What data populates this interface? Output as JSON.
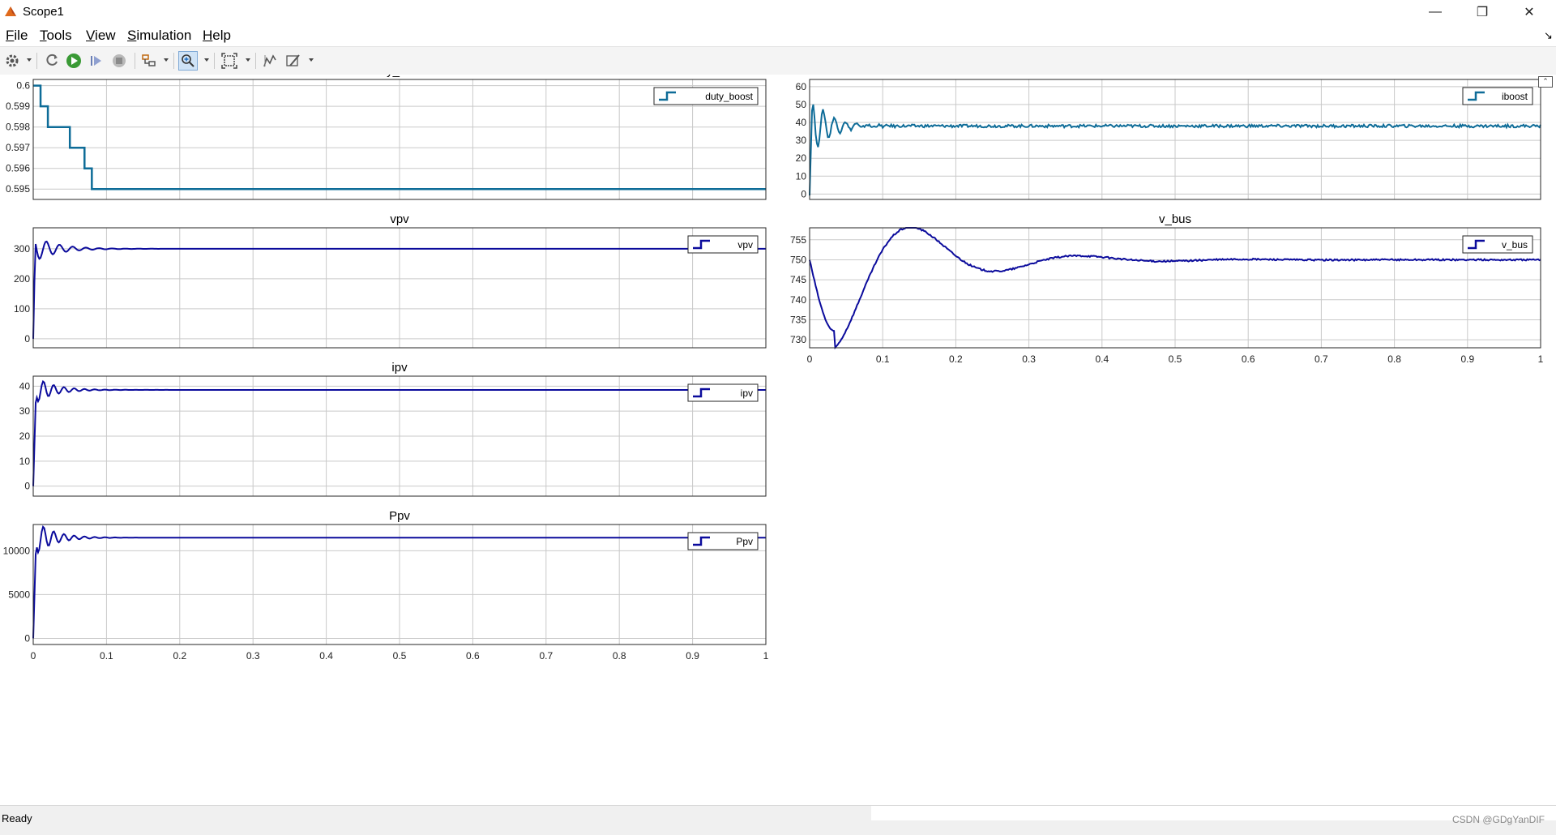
{
  "window": {
    "title": "Scope1",
    "minimize_glyph": "—",
    "maximize_glyph": "❐",
    "close_glyph": "✕"
  },
  "menu": {
    "items": [
      {
        "label": "File",
        "underline": "F",
        "rest": "ile"
      },
      {
        "label": "Tools",
        "underline": "T",
        "rest": "ools"
      },
      {
        "label": "View",
        "underline": "V",
        "rest": "iew"
      },
      {
        "label": "Simulation",
        "underline": "S",
        "rest": "imulation"
      },
      {
        "label": "Help",
        "underline": "H",
        "rest": "elp"
      }
    ],
    "undock_glyph": "↘"
  },
  "toolbar": {
    "icons": [
      "gear-icon",
      "step-back-icon",
      "run-icon",
      "step-forward-icon",
      "stop-icon",
      "highlight-icon",
      "zoom-icon",
      "fit-view-icon",
      "cursor-measure-icon",
      "style-icon"
    ]
  },
  "status": {
    "text": "Ready",
    "watermark": "CSDN @GDgYanDIF"
  },
  "chart_data": [
    {
      "type": "line",
      "title": "duty_boost",
      "legend": "duty_boost",
      "color": "#0e6c98",
      "xlim": [
        0,
        1
      ],
      "ylim": [
        0.5945,
        0.6003
      ],
      "yticks": [
        "0.6",
        "0.599",
        "0.598",
        "0.597",
        "0.596",
        "0.595"
      ],
      "xticks": [],
      "steps": [
        [
          0,
          0.6
        ],
        [
          0.01,
          0.599
        ],
        [
          0.02,
          0.598
        ],
        [
          0.05,
          0.597
        ],
        [
          0.07,
          0.596
        ],
        [
          0.08,
          0.595
        ],
        [
          1,
          0.595
        ]
      ]
    },
    {
      "type": "line",
      "title": "iboost",
      "legend": "iboost",
      "color": "#0e6c98",
      "xlim": [
        0,
        1
      ],
      "ylim": [
        -3,
        64
      ],
      "yticks": [
        "60",
        "50",
        "40",
        "30",
        "20",
        "10",
        "0"
      ],
      "xticks": [],
      "settle": 38,
      "peak": 56
    },
    {
      "type": "line",
      "title": "vpv",
      "legend": "vpv",
      "color": "#0b0b9c",
      "xlim": [
        0,
        1
      ],
      "ylim": [
        -30,
        370
      ],
      "yticks": [
        "300",
        "200",
        "100",
        "0"
      ],
      "xticks": [],
      "settle": 300,
      "peak": 345
    },
    {
      "type": "line",
      "title": "v_bus",
      "legend": "v_bus",
      "color": "#0b0b9c",
      "xlim": [
        0,
        1
      ],
      "ylim": [
        728,
        758
      ],
      "yticks": [
        "755",
        "750",
        "745",
        "740",
        "735",
        "730"
      ],
      "xticks": [
        "0",
        "0.1",
        "0.2",
        "0.3",
        "0.4",
        "0.5",
        "0.6",
        "0.7",
        "0.8",
        "0.9",
        "1"
      ],
      "settle": 750,
      "min": 732,
      "max": 757
    },
    {
      "type": "line",
      "title": "ipv",
      "legend": "ipv",
      "color": "#0b0b9c",
      "xlim": [
        0,
        1
      ],
      "ylim": [
        -4,
        44
      ],
      "yticks": [
        "40",
        "30",
        "20",
        "10",
        "0"
      ],
      "xticks": [],
      "settle": 38.5,
      "peak": 40
    },
    {
      "type": "line",
      "title": "Ppv",
      "legend": "Ppv",
      "color": "#0b0b9c",
      "xlim": [
        0,
        1
      ],
      "ylim": [
        -700,
        13000
      ],
      "yticks": [
        "10000",
        "5000",
        "0"
      ],
      "xticks": [
        "0",
        "0.1",
        "0.2",
        "0.3",
        "0.4",
        "0.5",
        "0.6",
        "0.7",
        "0.8",
        "0.9",
        "1"
      ],
      "settle": 11500,
      "peak": 11500
    }
  ]
}
